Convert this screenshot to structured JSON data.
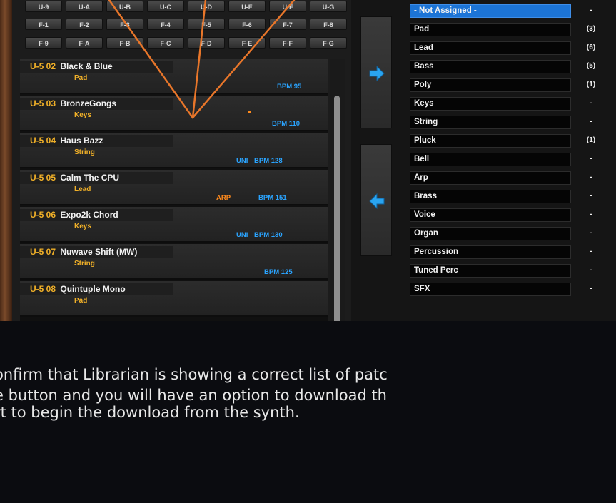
{
  "banks": {
    "row1": [
      "U-9",
      "U-A",
      "U-B",
      "U-C",
      "U-D",
      "U-E",
      "U-F",
      "U-G"
    ],
    "row2": [
      "F-1",
      "F-2",
      "F-3",
      "F-4",
      "F-5",
      "F-6",
      "F-7",
      "F-8"
    ],
    "row3": [
      "F-9",
      "F-A",
      "F-B",
      "F-C",
      "F-D",
      "F-E",
      "F-F",
      "F-G"
    ]
  },
  "patches": [
    {
      "num": "U-5 02",
      "name": "Black & Blue",
      "category": "Pad",
      "uni": "",
      "arp": "",
      "bpm": "BPM 95"
    },
    {
      "num": "U-5 03",
      "name": "BronzeGongs",
      "category": "Keys",
      "uni": "",
      "arp": "",
      "bpm": "BPM 110"
    },
    {
      "num": "U-5 04",
      "name": "Haus Bazz",
      "category": "String",
      "uni": "UNI",
      "arp": "",
      "bpm": "BPM 128"
    },
    {
      "num": "U-5 05",
      "name": "Calm The CPU",
      "category": "Lead",
      "uni": "",
      "arp": "ARP",
      "bpm": "BPM 151"
    },
    {
      "num": "U-5 06",
      "name": "Expo2k Chord",
      "category": "Keys",
      "uni": "UNI",
      "arp": "",
      "bpm": "BPM 130"
    },
    {
      "num": "U-5 07",
      "name": "Nuwave Shift (MW)",
      "category": "String",
      "uni": "",
      "arp": "",
      "bpm": "BPM 125"
    },
    {
      "num": "U-5 08",
      "name": "Quintuple Mono",
      "category": "Pad",
      "uni": "",
      "arp": "",
      "bpm": ""
    }
  ],
  "categories": [
    {
      "label": "- Not Assigned -",
      "count": "-"
    },
    {
      "label": "Pad",
      "count": "(3)"
    },
    {
      "label": "Lead",
      "count": "(6)"
    },
    {
      "label": "Bass",
      "count": "(5)"
    },
    {
      "label": "Poly",
      "count": "(1)"
    },
    {
      "label": "Keys",
      "count": "-"
    },
    {
      "label": "String",
      "count": "-"
    },
    {
      "label": "Pluck",
      "count": "(1)"
    },
    {
      "label": "Bell",
      "count": "-"
    },
    {
      "label": "Arp",
      "count": "-"
    },
    {
      "label": "Brass",
      "count": "-"
    },
    {
      "label": "Voice",
      "count": "-"
    },
    {
      "label": "Organ",
      "count": "-"
    },
    {
      "label": "Percussion",
      "count": "-"
    },
    {
      "label": "Tuned Perc",
      "count": "-"
    },
    {
      "label": "SFX",
      "count": "-"
    }
  ],
  "caption": {
    "line1": "onfirm that Librarian is showing a correct list of patc",
    "line2": "e button and you will have an option to download th",
    "line3": "rt to begin the download from the synth."
  },
  "icons": {
    "right_arrow": "arrow-right-icon",
    "left_arrow": "arrow-left-icon"
  },
  "colors": {
    "selected": "#1c74d6",
    "patch_number": "#f0b028",
    "bpm": "#2aa4ff",
    "arp": "#ff8a1c",
    "annotation": "#e8762a"
  }
}
